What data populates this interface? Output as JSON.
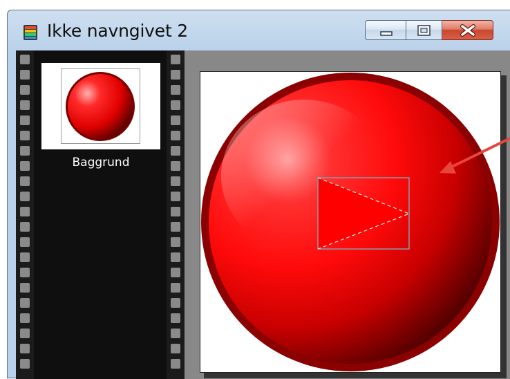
{
  "window": {
    "title": "Ikke navngivet 2",
    "icon": "film-app-icon",
    "controls": [
      "minimize",
      "maximize",
      "close"
    ]
  },
  "filmstrip": {
    "frames": [
      {
        "label": "Baggrund",
        "thumbnail": "red-sphere"
      }
    ]
  },
  "canvas": {
    "content": "red-glossy-play-button",
    "selection_shape": "triangle-in-rectangle"
  },
  "colors": {
    "sphere_red": "#ff1a1a",
    "sphere_dark": "#7a0000",
    "rim": "#8b0000",
    "arrow": "#e8453c",
    "filmstrip_bg": "#0f0f0f"
  }
}
